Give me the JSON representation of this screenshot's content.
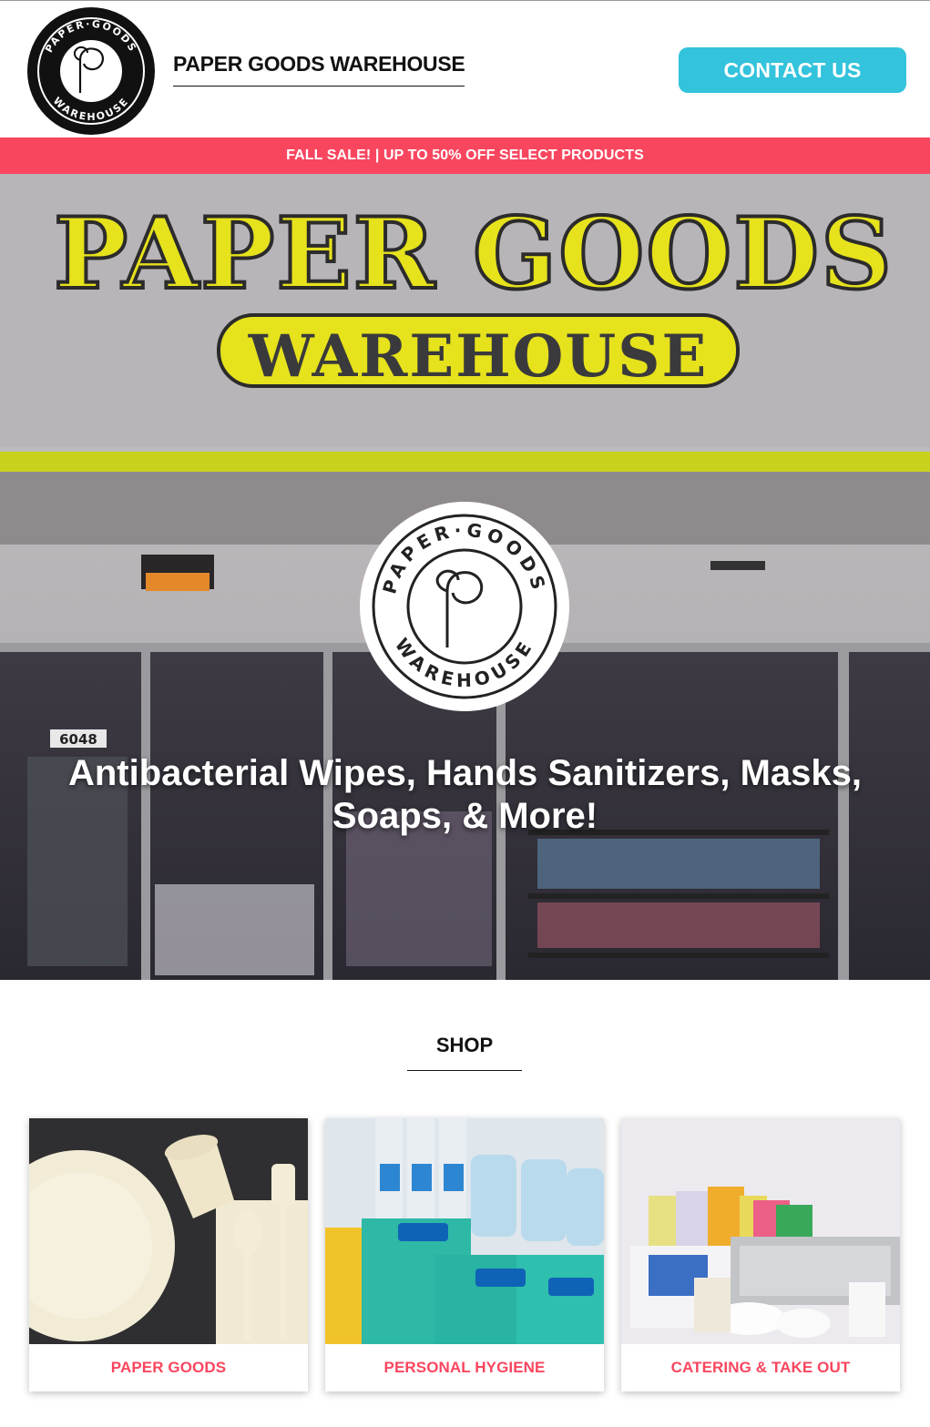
{
  "header": {
    "brand": "PAPER GOODS WAREHOUSE",
    "contact_label": "CONTACT US",
    "logo_text_top": "PAPER·GOODS",
    "logo_text_bottom": "WAREHOUSE"
  },
  "banner": {
    "sale_text": "FALL SALE! | UP TO 50% OFF SELECT PRODUCTS"
  },
  "hero": {
    "sign_line1": "PAPER GOODS",
    "sign_line2": "WAREHOUSE",
    "address_number": "6048",
    "title": "Antibacterial Wipes, Hands Sanitizers, Masks, Soaps, & More!"
  },
  "shop": {
    "heading": "SHOP",
    "categories": [
      {
        "label": "PAPER GOODS"
      },
      {
        "label": "PERSONAL HYGIENE"
      },
      {
        "label": "CATERING & TAKE OUT"
      }
    ]
  },
  "colors": {
    "accent_pink": "#f9465f",
    "accent_cyan": "#33c3dc",
    "sign_yellow": "#e6e21c"
  }
}
